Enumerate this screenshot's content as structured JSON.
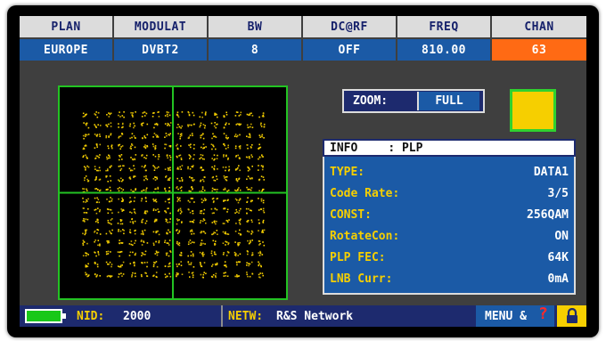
{
  "header": {
    "columns": [
      {
        "label": "PLAN",
        "value": "EUROPE"
      },
      {
        "label": "MODULAT",
        "value": "DVBT2"
      },
      {
        "label": "BW",
        "value": "8"
      },
      {
        "label": "DC@RF",
        "value": "OFF"
      },
      {
        "label": "FREQ",
        "value": "810.00"
      },
      {
        "label": "CHAN",
        "value": "63"
      }
    ]
  },
  "zoom": {
    "label": "ZOOM:",
    "value": "FULL"
  },
  "info": {
    "title": "INFO",
    "title_value": ": PLP",
    "rows": [
      {
        "key": "TYPE:",
        "value": "DATA1"
      },
      {
        "key": "Code Rate:",
        "value": "3/5"
      },
      {
        "key": "CONST:",
        "value": "256QAM"
      },
      {
        "key": "RotateCon:",
        "value": "ON"
      },
      {
        "key": "PLP FEC:",
        "value": "64K"
      },
      {
        "key": "LNB Curr:",
        "value": "0mA"
      }
    ]
  },
  "footer": {
    "nid_label": "NID:",
    "nid_value": "2000",
    "netw_label": "NETW:",
    "netw_value": "R&S Network",
    "menu_label": "MENU &",
    "help_glyph": "?"
  },
  "colors": {
    "accent": "#ff6a14",
    "panel_blue": "#1b5aa6",
    "navy": "#1d2a6e",
    "yellow": "#f6cf00",
    "green": "#23c323"
  },
  "icons": {
    "battery": "battery-icon",
    "lock": "lock-icon",
    "help": "question-icon"
  }
}
